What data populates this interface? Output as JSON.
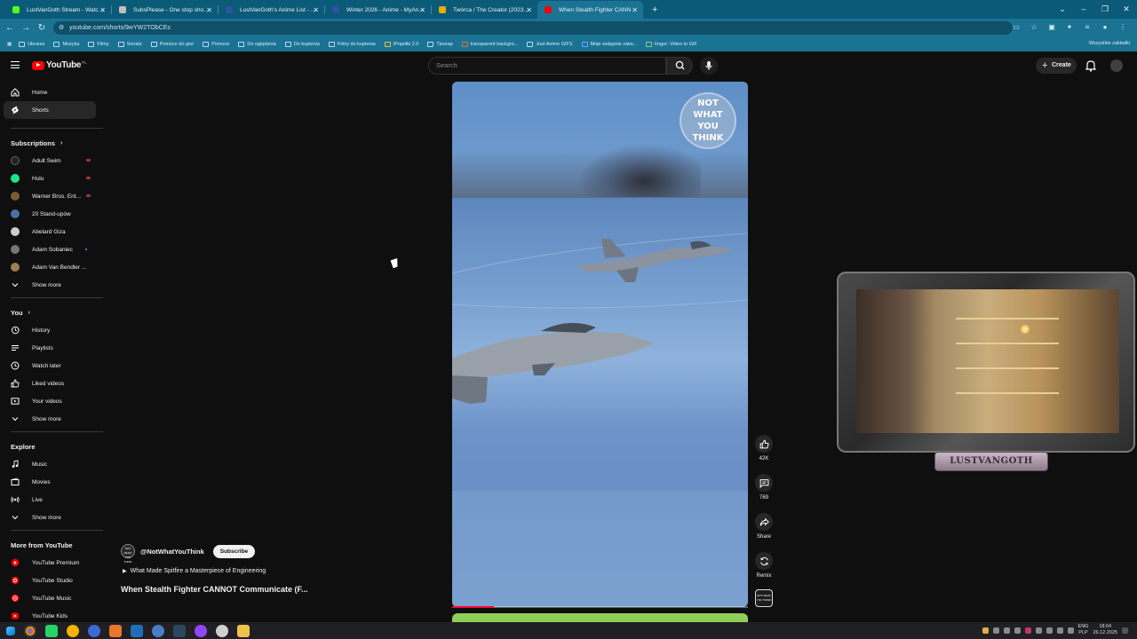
{
  "browser": {
    "tabs": [
      {
        "label": "LustVanGoth Stream - Watch Li",
        "favicon_color": "#53fc18",
        "active": false
      },
      {
        "label": "SubsPlease - One stop shop fo",
        "favicon_color": "#c0c0c0",
        "active": false
      },
      {
        "label": "LustVanGoth's Anime List - My",
        "favicon_color": "#2e51a2",
        "active": false
      },
      {
        "label": "Winter 2026 - Anime - MyAnim",
        "favicon_color": "#2e51a2",
        "active": false
      },
      {
        "label": "Twórca / The Creator (2023) - F",
        "favicon_color": "#e2b000",
        "active": false
      },
      {
        "label": "When Stealth Fighter CANN",
        "favicon_color": "#ff0000",
        "active": true
      }
    ],
    "url": "youtube.com/shorts/9wYW2TObCEs",
    "bookmarks": [
      "Ubrania",
      "Muzyka",
      "Filmy",
      "Seriale",
      "Pomoce do gier",
      "Pomoce",
      "Do oglądania",
      "Do kupienia",
      "Filmy do kupienia",
      "IPopołki 2.0",
      "Tpxeap",
      "transparent backgro...",
      "Just Anime GIFS",
      "Moje wstępnie zatw...",
      "Imgur: Video to GIF"
    ],
    "bookmarks_all": "Wszystkie zakładki"
  },
  "header": {
    "logo_text": "YouTube",
    "country_code": "PL",
    "search_placeholder": "Search",
    "create_label": "Create"
  },
  "sidebar": {
    "main": [
      {
        "label": "Home",
        "icon": "home-icon"
      },
      {
        "label": "Shorts",
        "icon": "shorts-icon",
        "active": true
      }
    ],
    "subscriptions_title": "Subscriptions",
    "subscriptions": [
      {
        "label": "Adult Swim",
        "color": "#222222",
        "live": true
      },
      {
        "label": "Hulu",
        "color": "#1ce783",
        "live": true
      },
      {
        "label": "Warner Bros. Ent...",
        "color": "#7a5c2e",
        "live": true
      },
      {
        "label": "20 Stand-upów",
        "color": "#4a6ea8",
        "live": false
      },
      {
        "label": "Abelard Giza",
        "color": "#cccccc",
        "live": false
      },
      {
        "label": "Adam Sobaniec",
        "color": "#777777",
        "live": false,
        "new": true
      },
      {
        "label": "Adam Van Bendler ...",
        "color": "#a07a50",
        "live": false
      }
    ],
    "subs_show_more": "Show more",
    "you_title": "You",
    "you": [
      {
        "label": "History",
        "icon": "history-icon"
      },
      {
        "label": "Playlists",
        "icon": "playlists-icon"
      },
      {
        "label": "Watch later",
        "icon": "watch-later-icon"
      },
      {
        "label": "Liked videos",
        "icon": "liked-videos-icon"
      },
      {
        "label": "Your videos",
        "icon": "your-videos-icon"
      }
    ],
    "you_show_more": "Show more",
    "explore_title": "Explore",
    "explore": [
      {
        "label": "Music",
        "icon": "music-icon"
      },
      {
        "label": "Movies",
        "icon": "movies-icon"
      },
      {
        "label": "Live",
        "icon": "live-icon"
      }
    ],
    "explore_show_more": "Show more",
    "more_title": "More from YouTube",
    "more": [
      {
        "label": "YouTube Premium"
      },
      {
        "label": "YouTube Studio"
      },
      {
        "label": "YouTube Music"
      },
      {
        "label": "YouTube Kids"
      }
    ]
  },
  "short": {
    "overlay_logo_lines": [
      "NOT",
      "WHAT",
      "YOU",
      "THINK"
    ],
    "channel_handle": "@NotWhatYouThink",
    "channel_avatar_text": "NOT WHAT YOU THINK",
    "subscribe_label": "Subscribe",
    "related_video": "What Made Spitfire a Masterpiece of Engineering",
    "title": "When Stealth Fighter CANNOT Communicate (F...",
    "progress": 0.14
  },
  "actions": [
    {
      "name": "like",
      "label": "42K",
      "icon": "thumbs-up-icon"
    },
    {
      "name": "comments",
      "label": "769",
      "icon": "comment-icon"
    },
    {
      "name": "share",
      "label": "Share",
      "icon": "share-icon"
    },
    {
      "name": "remix",
      "label": "Remix",
      "icon": "remix-icon"
    }
  ],
  "webcam": {
    "nameplate": "LUSTVANGOTH"
  },
  "taskbar": {
    "lang": "ENG",
    "region": "PLP",
    "time": "18:04",
    "date": "26.12.2025"
  }
}
